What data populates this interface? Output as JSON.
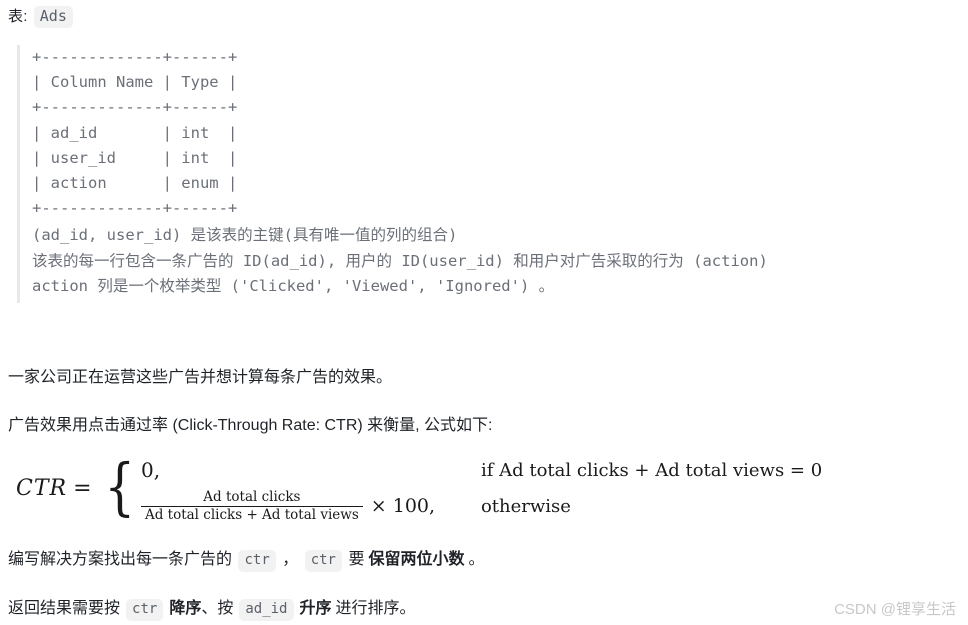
{
  "page": {
    "background": "#ffffff",
    "text_color": "#1f2328",
    "code_color": "#6b7078"
  },
  "table_header": {
    "label": "表:",
    "table_name": "Ads"
  },
  "schema": {
    "ascii": "+-------------+------+\n| Column Name | Type |\n+-------------+------+\n| ad_id       | int  |\n| user_id     | int  |\n| action      | enum |\n+-------------+------+",
    "notes": "(ad_id, user_id) 是该表的主键(具有唯一值的列的组合)\n该表的每一行包含一条广告的 ID(ad_id), 用户的 ID(user_id) 和用户对广告采取的行为 (action)\naction 列是一个枚举类型 ('Clicked', 'Viewed', 'Ignored') 。"
  },
  "paragraphs": {
    "company": "一家公司正在运营这些广告并想计算每条广告的效果。",
    "ctr_intro": "广告效果用点击通过率 (Click-Through Rate: CTR) 来衡量, 公式如下:",
    "solution_1": "编写解决方案找出每一条广告的",
    "solution_code_1": "ctr",
    "solution_comma": "，",
    "solution_code_2": "ctr",
    "solution_2": "要",
    "solution_bold": "保留两位小数",
    "solution_3": "。",
    "order_1": "返回结果需要按",
    "order_code_1": "ctr",
    "order_bold_1": "降序",
    "order_2": "、按",
    "order_code_2": "ad_id",
    "order_bold_2": "升序",
    "order_3": "进行排序。"
  },
  "formula": {
    "lhs": "CTR",
    "equals": "=",
    "case1_value": "0,",
    "case1_condition": "if Ad total clicks + Ad total views = 0",
    "case2_numerator": "Ad total clicks",
    "case2_denominator": "Ad total clicks + Ad total views",
    "case2_times": "× 100,",
    "case2_condition": "otherwise"
  },
  "watermark": {
    "text": "CSDN @锂享生活",
    "color": "#c8c8c8"
  }
}
